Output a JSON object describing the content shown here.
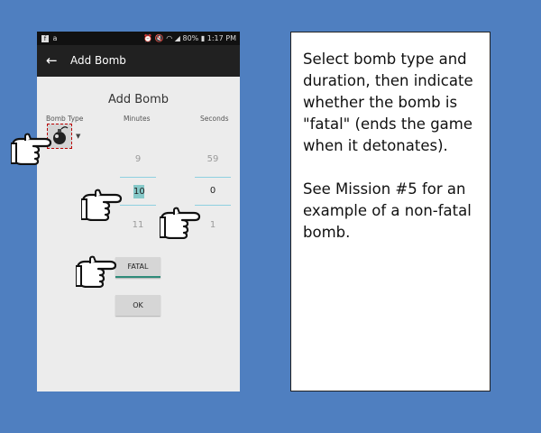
{
  "status_bar": {
    "left_icons": [
      "facebook-icon",
      "amazon-icon"
    ],
    "right_icons": [
      "alarm-icon",
      "mute-icon",
      "wifi-icon",
      "signal-icon"
    ],
    "battery": "80%",
    "time": "1:17 PM"
  },
  "toolbar": {
    "title": "Add Bomb",
    "back_glyph": "←"
  },
  "dialog": {
    "title": "Add Bomb",
    "col_bomb_type": "Bomb Type",
    "col_minutes": "Minutes",
    "col_seconds": "Seconds",
    "minutes": {
      "prev": "9",
      "current": "10",
      "next": "11"
    },
    "seconds": {
      "prev": "59",
      "current": "0",
      "next": "1"
    },
    "fatal_button": "FATAL",
    "ok_button": "OK"
  },
  "instruction": {
    "paragraph1": "Select bomb type and duration, then indicate whether the bomb is \"fatal\" (ends the game when it detonates).",
    "paragraph2": "See Mission #5 for an example of a non-fatal bomb."
  },
  "colors": {
    "background": "#4f7fc0",
    "accent_teal": "#2e8b79",
    "picker_underline": "#8ed0e0",
    "selection": "#86c9c9"
  }
}
